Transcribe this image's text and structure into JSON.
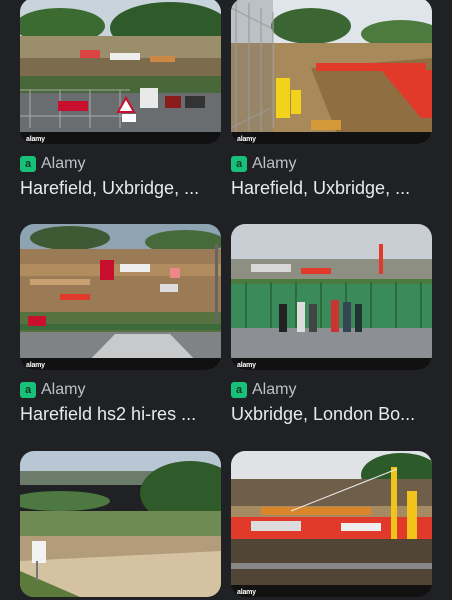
{
  "results": [
    {
      "source": "Alamy",
      "title": "Harefield, Uxbridge, ...",
      "watermark": "alamy"
    },
    {
      "source": "Alamy",
      "title": "Harefield, Uxbridge, ...",
      "watermark": "alamy"
    },
    {
      "source": "Alamy",
      "title": "Harefield hs2 hi-res ...",
      "watermark": "alamy"
    },
    {
      "source": "Alamy",
      "title": "Uxbridge, London Bo...",
      "watermark": "alamy"
    },
    {
      "source": "",
      "title": "",
      "watermark": ""
    },
    {
      "source": "",
      "title": "",
      "watermark": "alamy"
    }
  ],
  "favicon_letter": "a",
  "colors": {
    "background": "#202124",
    "favicon": "#18c07a",
    "title_text": "#e8eaed",
    "source_text": "#bdc1c6"
  }
}
